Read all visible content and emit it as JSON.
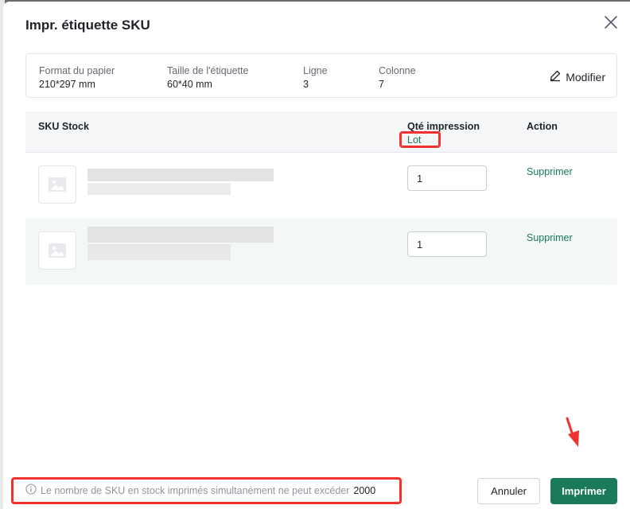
{
  "dialog": {
    "title": "Impr. étiquette SKU"
  },
  "paper_info": {
    "format_label": "Format du papier",
    "format_value": "210*297 mm",
    "label_size_label": "Taille de l'étiquette",
    "label_size_value": "60*40 mm",
    "row_label": "Ligne",
    "row_value": "3",
    "column_label": "Colonne",
    "column_value": "7",
    "edit_label": "Modifier"
  },
  "table": {
    "headers": {
      "sku": "SKU Stock",
      "qty": "Qté impression",
      "action": "Action"
    },
    "batch_label": "Lot",
    "rows": [
      {
        "qty": "1",
        "action": "Supprimer"
      },
      {
        "qty": "1",
        "action": "Supprimer"
      }
    ]
  },
  "footer": {
    "note": "Le nombre de SKU en stock imprimés simultanément ne peut excéder",
    "limit": "2000",
    "cancel_label": "Annuler",
    "print_label": "Imprimer"
  },
  "colors": {
    "accent": "#1a7a5a",
    "highlight": "#f0332e"
  }
}
